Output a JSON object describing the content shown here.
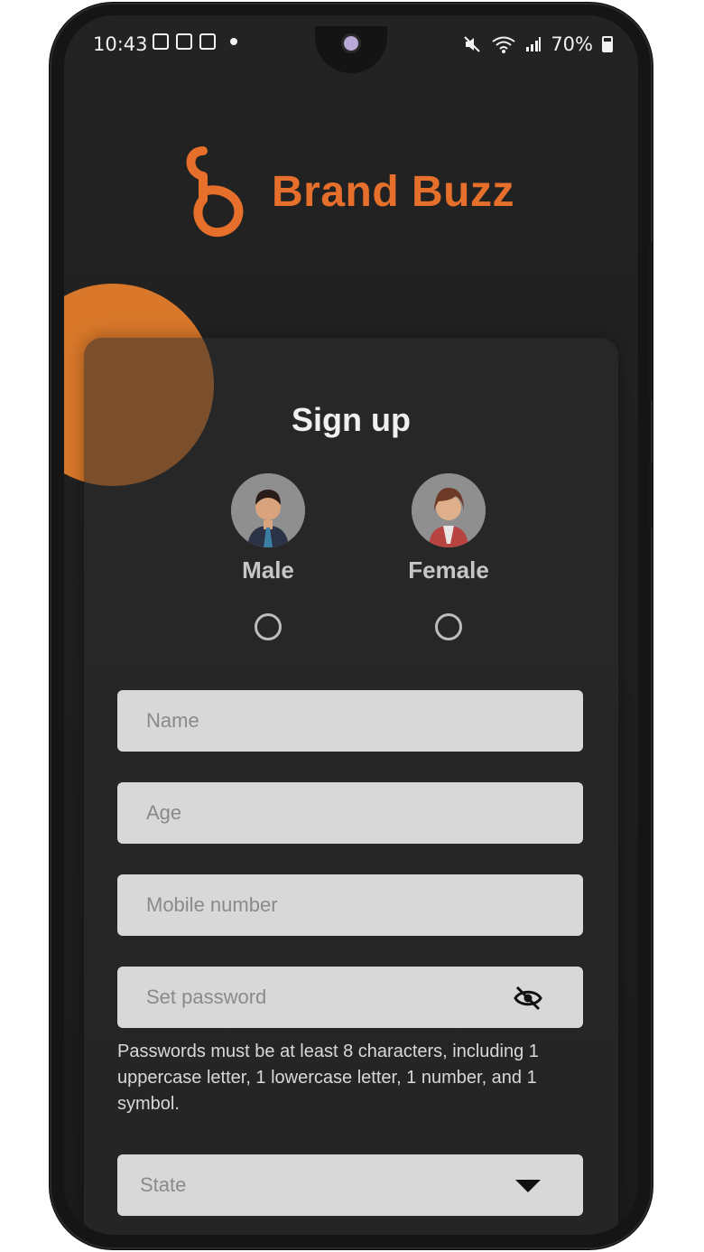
{
  "status_bar": {
    "time": "10:43",
    "battery": "70%"
  },
  "brand": {
    "name": "Brand Buzz",
    "accent_color": "#E56F2B"
  },
  "signup": {
    "title": "Sign up",
    "genders": [
      {
        "label": "Male",
        "icon": "male-avatar-icon"
      },
      {
        "label": "Female",
        "icon": "female-avatar-icon"
      }
    ],
    "fields": {
      "name_placeholder": "Name",
      "age_placeholder": "Age",
      "mobile_placeholder": "Mobile number",
      "password_placeholder": "Set password",
      "state_placeholder": "State"
    },
    "password_hint": "Passwords must be at least 8 characters, including 1 uppercase letter, 1 lowercase letter, 1 number, and 1 symbol."
  },
  "icons": {
    "password_visibility": "eye-off-icon",
    "state_dropdown": "chevron-down-icon"
  }
}
